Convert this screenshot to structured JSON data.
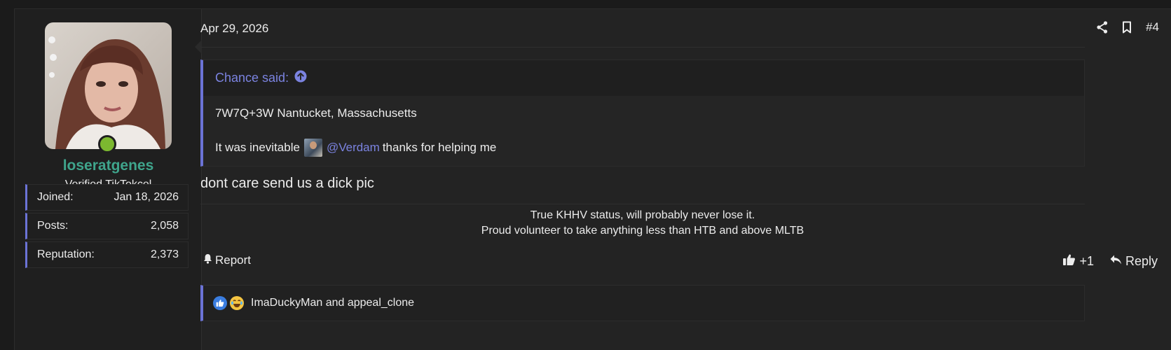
{
  "post": {
    "date": "Apr 29, 2026",
    "post_number": "#4",
    "user": {
      "username": "loseratgenes",
      "title": "Verified TikTokcel",
      "online": true,
      "stats": [
        {
          "label": "Joined:",
          "value": "Jan 18, 2026"
        },
        {
          "label": "Posts:",
          "value": "2,058"
        },
        {
          "label": "Reputation:",
          "value": "2,373"
        }
      ]
    },
    "quote": {
      "author_line": "Chance said:",
      "line1": "7W7Q+3W Nantucket, Massachusetts",
      "line2_before": "It was inevitable",
      "mention": "@Verdam",
      "line2_after": "thanks for helping me"
    },
    "body": "dont care send us a dick pic",
    "signature": [
      "True KHHV status, will probably never lose it.",
      "Proud volunteer to take anything less than HTB and above MLTB"
    ],
    "report_label": "Report",
    "like_label": "+1",
    "reply_label": "Reply",
    "reactions_text": "ImaDuckyMan and appeal_clone"
  },
  "colors": {
    "accent": "#6b73d6",
    "link": "#7b83e0",
    "username": "#3fa58c",
    "online": "#7cb830",
    "background": "#232323"
  },
  "icons": [
    "share-icon",
    "bookmark-icon",
    "arrow-up-circle-icon",
    "bell-icon",
    "thumbs-up-icon",
    "reply-icon",
    "like-reaction-icon",
    "laugh-reaction-icon"
  ]
}
